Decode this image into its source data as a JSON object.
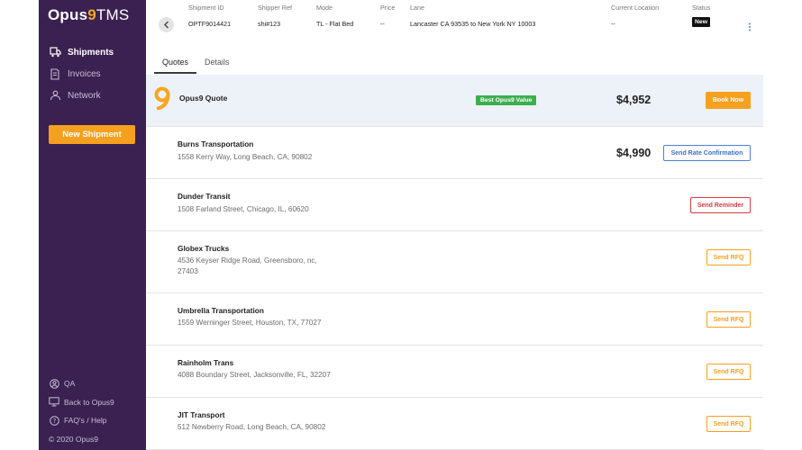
{
  "brand": {
    "name_prefix": "Opus",
    "name_nine": "9",
    "name_suffix": "TMS"
  },
  "sidebar": {
    "items": [
      {
        "label": "Shipments",
        "icon": "truck-icon",
        "active": true
      },
      {
        "label": "Invoices",
        "icon": "invoice-icon",
        "active": false
      },
      {
        "label": "Network",
        "icon": "network-icon",
        "active": false
      }
    ],
    "new_shipment_label": "New Shipment",
    "footer": [
      {
        "label": "QA",
        "icon": "user-circle-icon"
      },
      {
        "label": "Back to Opus9",
        "icon": "monitor-icon"
      },
      {
        "label": "FAQ's / Help",
        "icon": "help-icon"
      },
      {
        "label": "© 2020 Opus9",
        "icon": ""
      }
    ]
  },
  "header": {
    "shipment_id": {
      "label": "Shipment ID",
      "value": "OPTF9014421"
    },
    "shipper_ref": {
      "label": "Shipper Ref",
      "value": "shi#123"
    },
    "mode": {
      "label": "Mode",
      "value": "TL - Flat Bed"
    },
    "price": {
      "label": "Price",
      "value": "--"
    },
    "lane": {
      "label": "Lane",
      "value": "Lancaster CA 93535 to  New York NY 10003"
    },
    "current_location": {
      "label": "Current Location",
      "value": "--"
    },
    "status": {
      "label": "Status",
      "value": "New"
    }
  },
  "tabs": [
    {
      "label": "Quotes",
      "active": true
    },
    {
      "label": "Details",
      "active": false
    }
  ],
  "opus_quote": {
    "title": "Opus9 Quote",
    "badge": "Best Opus9 Value",
    "price": "$4,952",
    "action": "Book Now"
  },
  "carriers": [
    {
      "name": "Burns Transportation",
      "address": "1558 Kerry Way, Long Beach, CA, 90802",
      "price": "$4,990",
      "action": "Send Rate Confirmation",
      "action_type": "confirm"
    },
    {
      "name": "Dunder Transit",
      "address": "1508 Farland Street, Chicago, IL, 60620",
      "price": "",
      "action": "Send Reminder",
      "action_type": "remind"
    },
    {
      "name": "Globex Trucks",
      "address": "4536 Keyser Ridge Road, Greensboro, nc, 27403",
      "price": "",
      "action": "Send RFQ",
      "action_type": "rfq"
    },
    {
      "name": "Umbrella Transportation",
      "address": "1559 Werninger Street, Houston, TX, 77027",
      "price": "",
      "action": "Send RFQ",
      "action_type": "rfq"
    },
    {
      "name": "Rainholm Trans",
      "address": "4088 Boundary Street, Jacksonville, FL, 32207",
      "price": "",
      "action": "Send RFQ",
      "action_type": "rfq"
    },
    {
      "name": "JIT Transport",
      "address": "512 Newberry Road, Long Beach, CA, 90802",
      "price": "",
      "action": "Send RFQ",
      "action_type": "rfq"
    }
  ],
  "colors": {
    "sidebar_bg": "#3a2151",
    "accent_orange": "#f5a01f",
    "badge_green": "#3dae4e",
    "confirm_blue": "#4f7fd1",
    "remind_red": "#d93b46"
  }
}
